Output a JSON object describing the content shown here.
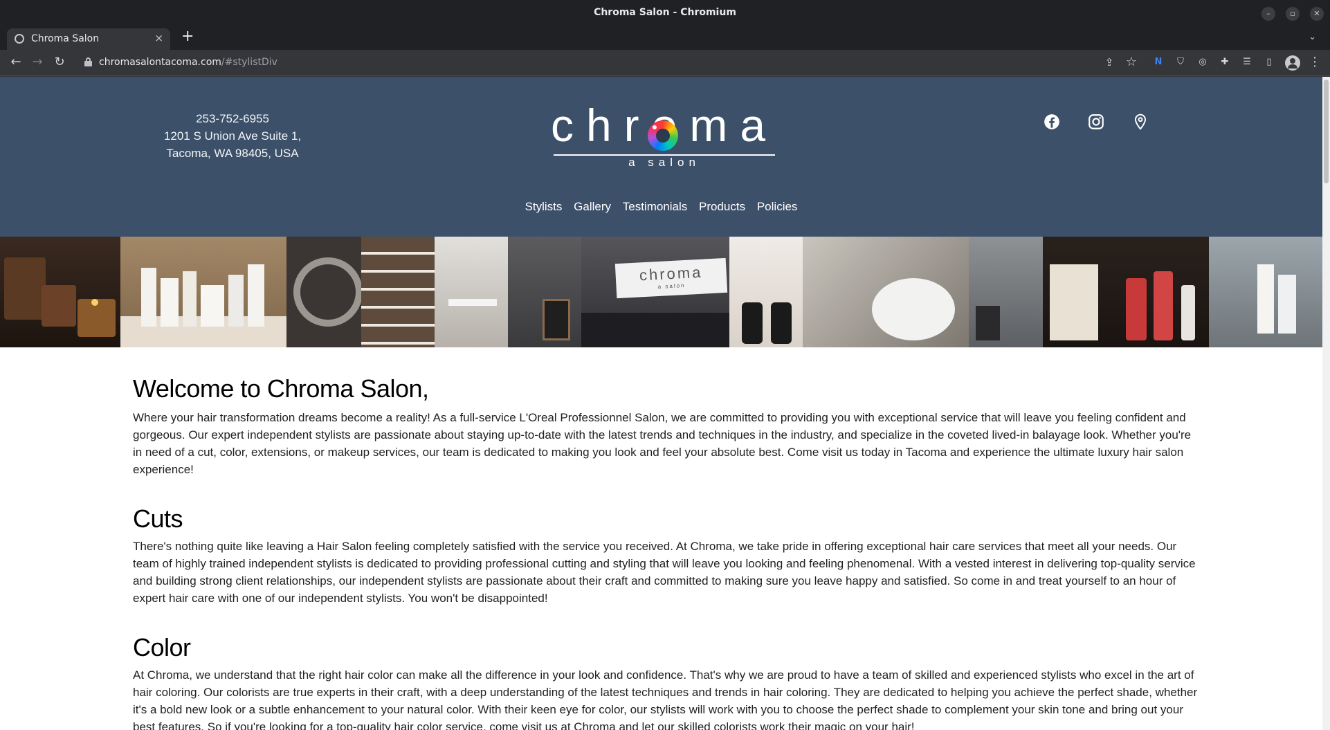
{
  "window": {
    "title": "Chroma Salon - Chromium",
    "minimize": "–",
    "maximize": "▫",
    "close": "✕"
  },
  "tab": {
    "label": "Chroma Salon",
    "close": "×",
    "new_tab": "+",
    "tab_search": "⌄"
  },
  "toolbar": {
    "back": "←",
    "forward": "→",
    "reload": "↻",
    "url_host": "chromasalontacoma.com",
    "url_path": "/#stylistDiv",
    "share": "⇪",
    "bookmark": "☆",
    "menu": "⋮"
  },
  "extensions": [
    "N",
    "⛉",
    "◎",
    "✚",
    "☰",
    "▯"
  ],
  "header": {
    "phone": "253-752-6955",
    "address_line1": "1201 S Union Ave Suite 1,",
    "address_line2": "Tacoma, WA 98405, USA",
    "logo_word": "chroma",
    "logo_sub": "a salon",
    "social": [
      "facebook-icon",
      "instagram-icon",
      "location-pin-icon"
    ],
    "nav": [
      "Stylists",
      "Gallery",
      "Testimonials",
      "Products",
      "Policies"
    ]
  },
  "gallery_strip": {
    "photo_tones": [
      "#2e2018",
      "#9a846a",
      "#3a3532",
      "#6e5f52",
      "#c9c4bd",
      "#4a4848",
      "#3f3f44",
      "#e4ded6",
      "#8c8a86",
      "#6a6c6e",
      "#2c2420",
      "#8a9aa4"
    ],
    "sign_text": "chroma",
    "sign_sub": "a salon"
  },
  "content": {
    "welcome_title": "Welcome to Chroma Salon,",
    "welcome_body": "Where your hair transformation dreams become a reality! As a full-service L'Oreal Professionnel Salon, we are committed to providing you with exceptional service that will leave you feeling confident and gorgeous. Our expert independent stylists are passionate about staying up-to-date with the latest trends and techniques in the industry, and specialize in the coveted lived-in balayage look. Whether you're in need of a cut, color, extensions, or makeup services, our team is dedicated to making you look and feel your absolute best. Come visit us today in Tacoma and experience the ultimate luxury hair salon experience!",
    "cuts_title": "Cuts",
    "cuts_body": "There's nothing quite like leaving a Hair Salon feeling completely satisfied with the service you received. At Chroma, we take pride in offering exceptional hair care services that meet all your needs. Our team of highly trained independent stylists is dedicated to providing professional cutting and styling that will leave you looking and feeling phenomenal. With a vested interest in delivering top-quality service and building strong client relationships, our independent stylists are passionate about their craft and committed to making sure you leave happy and satisfied. So come in and treat yourself to an hour of expert hair care with one of our independent stylists. You won't be disappointed!",
    "color_title": "Color",
    "color_body": "At Chroma, we understand that the right hair color can make all the difference in your look and confidence. That's why we are proud to have a team of skilled and experienced stylists who excel in the art of hair coloring. Our colorists are true experts in their craft, with a deep understanding of the latest techniques and trends in hair coloring. They are dedicated to helping you achieve the perfect shade, whether it's a bold new look or a subtle enhancement to your natural color. With their keen eye for color, our stylists will work with you to choose the perfect shade to complement your skin tone and bring out your best features. So if you're looking for a top-quality hair color service, come visit us at Chroma and let our skilled colorists work their magic on your hair!"
  }
}
